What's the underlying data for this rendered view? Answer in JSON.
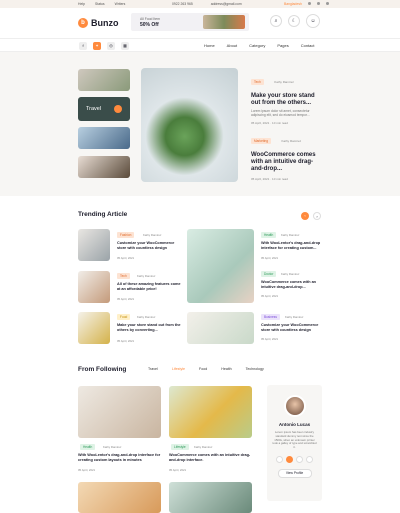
{
  "topbar": {
    "links": [
      "Help",
      "Status",
      "Writers"
    ],
    "phone": "0922 263 965",
    "email": "address@gmail.com",
    "lang": "Bangladesh"
  },
  "header": {
    "logo": "Bunzo",
    "promo_line1": "All Food Item",
    "promo_line2": "50% Off"
  },
  "nav": {
    "menu": [
      "Home",
      "About",
      "Category",
      "Pages",
      "Contact"
    ]
  },
  "hero": {
    "thumb_label": "Travel",
    "posts": [
      {
        "tag": "Tech",
        "author": "Kathy Ramirez",
        "title": "Make your store stand out from the others...",
        "desc": "Lorem ipsum dolor sit amet, consectetur adipiscing elit, sed do eiusmod tempor...",
        "date": "05 April, 2021",
        "read": "10 min read"
      },
      {
        "tag": "Marketing",
        "author": "Kathy Ramirez",
        "title": "WooCommerce comes with an intuitive drag-and-drop...",
        "date": "05 April, 2021",
        "read": "10 min read"
      }
    ]
  },
  "trending": {
    "title": "Trending Article",
    "items": [
      {
        "tag": "Fashion",
        "author": "Kathy Ramirez",
        "title": "Customize your WooCommerce store with countless design",
        "date": "05 April, 2021",
        "read": "10 min read"
      },
      {
        "tag": "Tech",
        "author": "Kathy Ramirez",
        "title": "All of these amazing features come at an affordable price!",
        "date": "05 April, 2021",
        "read": "10 min read"
      },
      {
        "tag": "Food",
        "author": "Kathy Ramirez",
        "title": "Make your store stand out from the others by converting...",
        "date": "05 April, 2021",
        "read": "10 min read"
      },
      {
        "tag": "Health",
        "author": "Kathy Ramirez",
        "title": "With WooLentor's drag-and-drop interface for creating custom...",
        "date": "05 April, 2021",
        "read": "10 min read"
      },
      {
        "tag": "Doctor",
        "author": "Kathy Ramirez",
        "title": "WooCommerce comes with an intuitive drag-and-drop...",
        "date": "05 April, 2021",
        "read": "10 min read"
      },
      {
        "tag": "Business",
        "author": "Kathy Ramirez",
        "title": "Customize your WooCommerce store with countless design",
        "date": "05 April, 2021",
        "read": "10 min read"
      }
    ]
  },
  "following": {
    "title": "From Following",
    "tabs": [
      "Travel",
      "Lifestyle",
      "Food",
      "Health",
      "Technology"
    ],
    "posts": [
      {
        "tag": "Health",
        "author": "Kathy Ramirez",
        "title": "With WooLentor's drag-and-drop interface for creating custom layouts in minutes",
        "date": "05 April, 2021",
        "read": "10 min read"
      },
      {
        "tag": "Lifestyle",
        "author": "Kathy Ramirez",
        "title": "WooCommerce comes with an intuitive drag-and-drop interface.",
        "date": "05 April, 2021",
        "read": "10 min read"
      }
    ]
  },
  "profile": {
    "name": "Antonio Lucas",
    "bio": "Lorem ipsum has been industry standard dummy text since the 1500s, when an unknown printer took a galley of type and scrambled it.",
    "button": "View Profile"
  },
  "colors": {
    "accent": "#ff8a3d",
    "bg": "#f7f6f4"
  }
}
